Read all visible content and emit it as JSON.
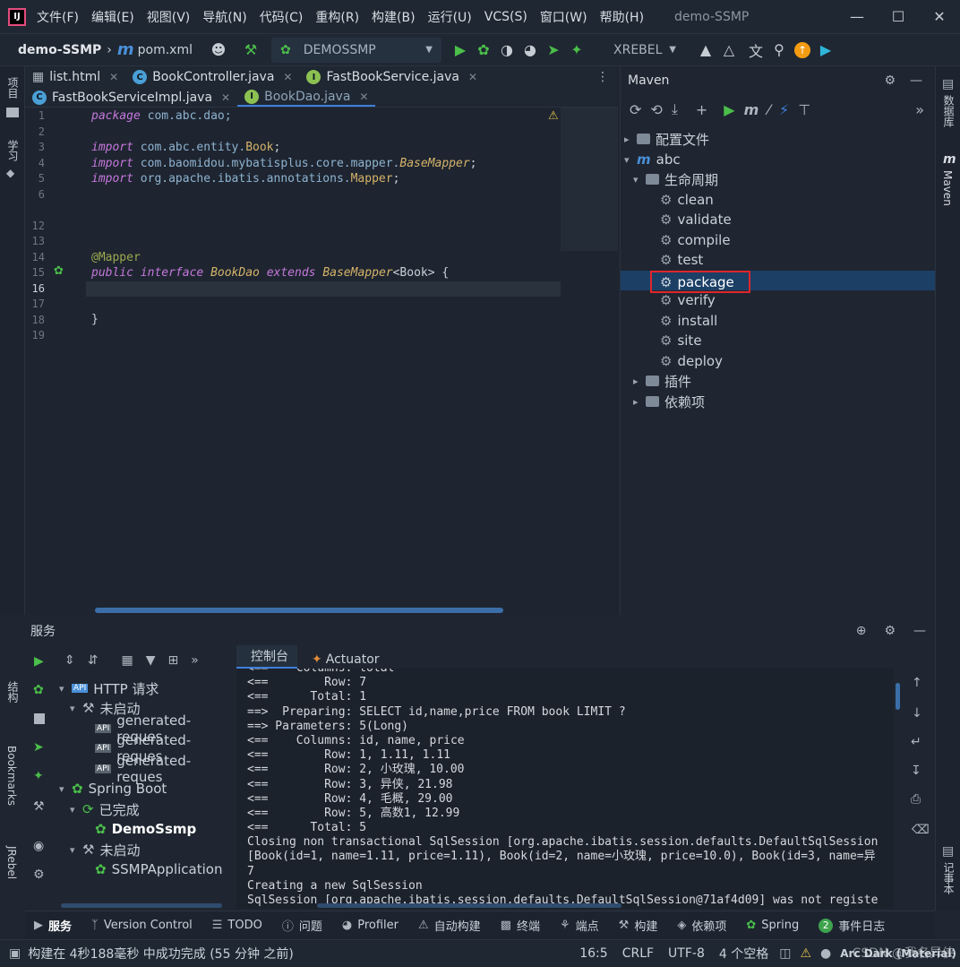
{
  "app": {
    "project_title": "demo-SSMP",
    "menu": [
      "文件(F)",
      "编辑(E)",
      "视图(V)",
      "导航(N)",
      "代码(C)",
      "重构(R)",
      "构建(B)",
      "运行(U)",
      "VCS(S)",
      "窗口(W)",
      "帮助(H)"
    ]
  },
  "toolbar": {
    "project": "demo-SSMP",
    "file": "pom.xml",
    "run_config": "DEMOSSMP",
    "xrebel": "XREBEL"
  },
  "left_strip": {
    "project": "项目",
    "learn": "学习",
    "structure": "结构",
    "bookmarks": "Bookmarks",
    "jrebel": "JRebel"
  },
  "right_strip": {
    "database": "数据库",
    "maven": "Maven",
    "notebook": "记事本"
  },
  "editor": {
    "tabs_row1": [
      {
        "label": "list.html",
        "icon": "html-file-icon"
      },
      {
        "label": "BookController.java",
        "icon": "class-icon"
      },
      {
        "label": "FastBookService.java",
        "icon": "interface-icon"
      }
    ],
    "tabs_row2": [
      {
        "label": "FastBookServiceImpl.java",
        "icon": "class-icon"
      },
      {
        "label": "BookDao.java",
        "icon": "interface-icon",
        "active": true
      }
    ],
    "line_numbers": [
      "1",
      "2",
      "3",
      "4",
      "5",
      "6",
      "12",
      "13",
      "14",
      "15",
      "16",
      "17",
      "18",
      "19"
    ],
    "code": {
      "l1_kw": "package",
      "l1_rest": " com.abc.dao;",
      "l3_kw": "import",
      "l3_pkg": " com.abc.entity.",
      "l3_cls": "Book",
      "l3_end": ";",
      "l4_kw": "import",
      "l4_pkg": " com.baomidou.mybatisplus.core.mapper.",
      "l4_cls": "BaseMapper",
      "l4_end": ";",
      "l5_kw": "import",
      "l5_pkg": " org.apache.ibatis.annotations.",
      "l5_cls": "Mapper",
      "l5_end": ";",
      "l14_ann": "@Mapper",
      "l15_kw1": "public",
      "l15_kw2": " interface",
      "l15_name": " BookDao",
      "l15_kw3": " extends",
      "l15_base": " BaseMapper",
      "l15_gen": "<Book>",
      "l15_end": " {",
      "l18": "}"
    }
  },
  "maven": {
    "title": "Maven",
    "nodes": {
      "config": "配置文件",
      "project": "abc",
      "lifecycle": "生命周期",
      "goals": [
        "clean",
        "validate",
        "compile",
        "test",
        "package",
        "verify",
        "install",
        "site",
        "deploy"
      ],
      "selected_goal": "package",
      "plugins": "插件",
      "dependencies": "依赖项"
    }
  },
  "services": {
    "title": "服务",
    "tree": {
      "http": "HTTP 请求",
      "not_started_1": "未启动",
      "requests": [
        "generated-reques",
        "generated-reques",
        "generated-reques"
      ],
      "spring_boot": "Spring Boot",
      "finished": "已完成",
      "demo": "DemoSsmp",
      "not_started_2": "未启动",
      "ssmp_app": "SSMPApplication"
    },
    "console_tabs": {
      "console": "控制台",
      "actuator": "Actuator"
    },
    "console_lines": [
      "<==    Columns: total",
      "<==        Row: 7",
      "<==      Total: 1",
      "==>  Preparing: SELECT id,name,price FROM book LIMIT ?",
      "==> Parameters: 5(Long)",
      "<==    Columns: id, name, price",
      "<==        Row: 1, 1.11, 1.11",
      "<==        Row: 2, 小玫瑰, 10.00",
      "<==        Row: 3, 异侠, 21.98",
      "<==        Row: 4, 毛概, 29.00",
      "<==        Row: 5, 高数1, 12.99",
      "<==      Total: 5",
      "Closing non transactional SqlSession [org.apache.ibatis.session.defaults.DefaultSqlSession",
      "[Book(id=1, name=1.11, price=1.11), Book(id=2, name=小玫瑰, price=10.0), Book(id=3, name=异",
      "7",
      "Creating a new SqlSession",
      "SqlSession [org.apache.ibatis.session.defaults.DefaultSqlSession@71af4d09] was not registe"
    ]
  },
  "toolwindows": [
    {
      "label": "服务",
      "icon": "play-icon"
    },
    {
      "label": "Version Control",
      "icon": "branch-icon"
    },
    {
      "label": "TODO",
      "icon": "list-icon"
    },
    {
      "label": "问题",
      "icon": "info-icon"
    },
    {
      "label": "Profiler",
      "icon": "profiler-icon"
    },
    {
      "label": "自动构建",
      "icon": "warning-icon"
    },
    {
      "label": "终端",
      "icon": "terminal-icon"
    },
    {
      "label": "端点",
      "icon": "endpoints-icon"
    },
    {
      "label": "构建",
      "icon": "hammer-icon"
    },
    {
      "label": "依赖项",
      "icon": "layers-icon"
    },
    {
      "label": "Spring",
      "icon": "spring-icon"
    },
    {
      "label": "事件日志",
      "icon": "event-log-icon",
      "badge": "2"
    }
  ],
  "status": {
    "message": "构建在 4秒188毫秒 中成功完成 (55 分钟 之前)",
    "position": "16:5",
    "line_sep": "CRLF",
    "encoding": "UTF-8",
    "indent": "4 个空格",
    "theme": "Arc Dark (Material)",
    "watermark": "CSDN @我名异侠"
  },
  "colors": {
    "accent": "#3f7fd9",
    "selection": "#1c3f66",
    "highlight_box": "#e0262b",
    "run_green": "#4bbf4a"
  }
}
